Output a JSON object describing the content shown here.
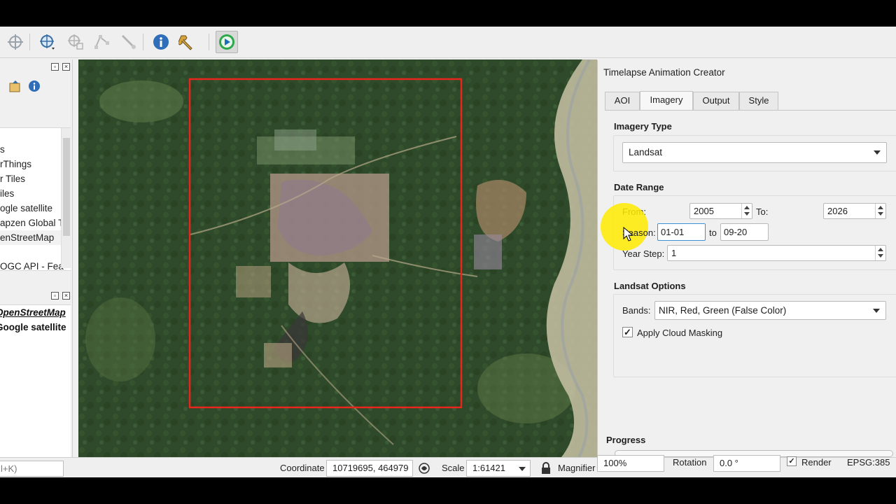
{
  "window": {
    "background": "#000000"
  },
  "toolbar": {
    "buttons": [
      {
        "name": "pan-map-icon"
      },
      {
        "name": "identify-features-icon"
      },
      {
        "name": "select-features-icon"
      },
      {
        "name": "vertex-tool-icon"
      },
      {
        "name": "measure-tool-icon"
      },
      {
        "name": "info-icon"
      },
      {
        "name": "wrench-icon"
      },
      {
        "name": "timelapse-plugin-icon"
      }
    ]
  },
  "browser": {
    "items": [
      "s",
      "rThings",
      "r Tiles",
      "iles",
      "ogle satellite",
      "apzen Global T",
      "enStreetMap",
      "",
      "OGC API - Fea"
    ]
  },
  "layers": {
    "items": [
      "OpenStreetMap",
      "Google satellite"
    ]
  },
  "panel": {
    "title": "Timelapse Animation Creator",
    "tabs": [
      "AOI",
      "Imagery",
      "Output",
      "Style"
    ],
    "active_tab": "Imagery",
    "imagery_type": {
      "title": "Imagery Type",
      "value": "Landsat"
    },
    "date_range": {
      "title": "Date Range",
      "from_label": "From:",
      "from_value": "2005",
      "to_label": "To:",
      "to_value": "2026",
      "season_label": "Season:",
      "season_start": "01-01",
      "season_to_label": "to",
      "season_end": "09-20",
      "year_step_label": "Year Step:",
      "year_step_value": "1"
    },
    "landsat_options": {
      "title": "Landsat Options",
      "bands_label": "Bands:",
      "bands_value": "NIR, Red, Green (False Color)",
      "cloud_masking_label": "Apply Cloud Masking",
      "cloud_masking_checked": true,
      "check_glyph": "✓"
    },
    "progress": {
      "title": "Progress",
      "value": 0
    }
  },
  "statusbar": {
    "locator_placeholder": "l+K)",
    "coordinate_label": "Coordinate",
    "coordinate_value": "10719695, 464979",
    "scale_label": "Scale",
    "scale_value": "1:61421",
    "magnifier_label": "Magnifier",
    "magnifier_value": "100%",
    "rotation_label": "Rotation",
    "rotation_value": "0.0 °",
    "render_label": "Render",
    "render_checked": true,
    "crs_value": "EPSG:385"
  },
  "map": {
    "aoi_color": "#e8261c",
    "highlight_color": "#ffeb00"
  }
}
